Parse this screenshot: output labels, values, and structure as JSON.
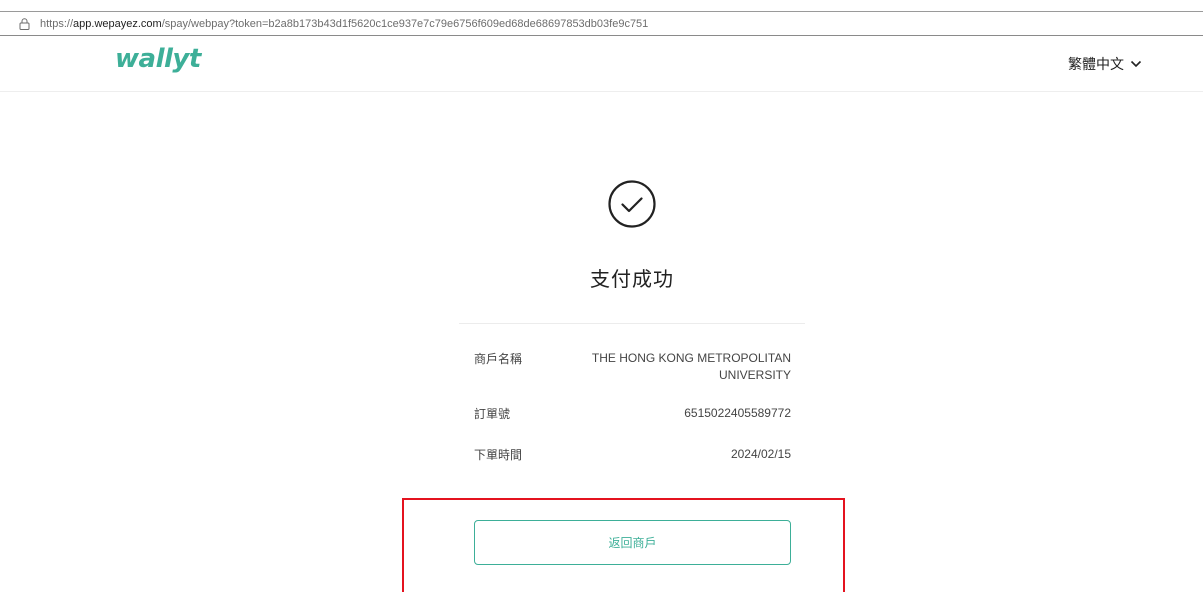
{
  "browser": {
    "url_prefix": "https://",
    "url_host": "app.wepayez.com",
    "url_path": "/spay/webpay?token=b2a8b173b43d1f5620c1ce937e7c79e6756f609ed68de68697853db03fe9c751"
  },
  "header": {
    "logo_text": "wallyt",
    "language_label": "繁體中文"
  },
  "result": {
    "title": "支付成功"
  },
  "details": {
    "merchant_label": "商戶名稱",
    "merchant_value": "THE HONG KONG METROPOLITAN UNIVERSITY",
    "order_label": "訂單號",
    "order_value": "6515022405589772",
    "time_label": "下單時間",
    "time_value": "2024/02/15"
  },
  "actions": {
    "back_label": "返回商戶"
  },
  "colors": {
    "brand": "#3daf98",
    "highlight_border": "#e4131f"
  }
}
